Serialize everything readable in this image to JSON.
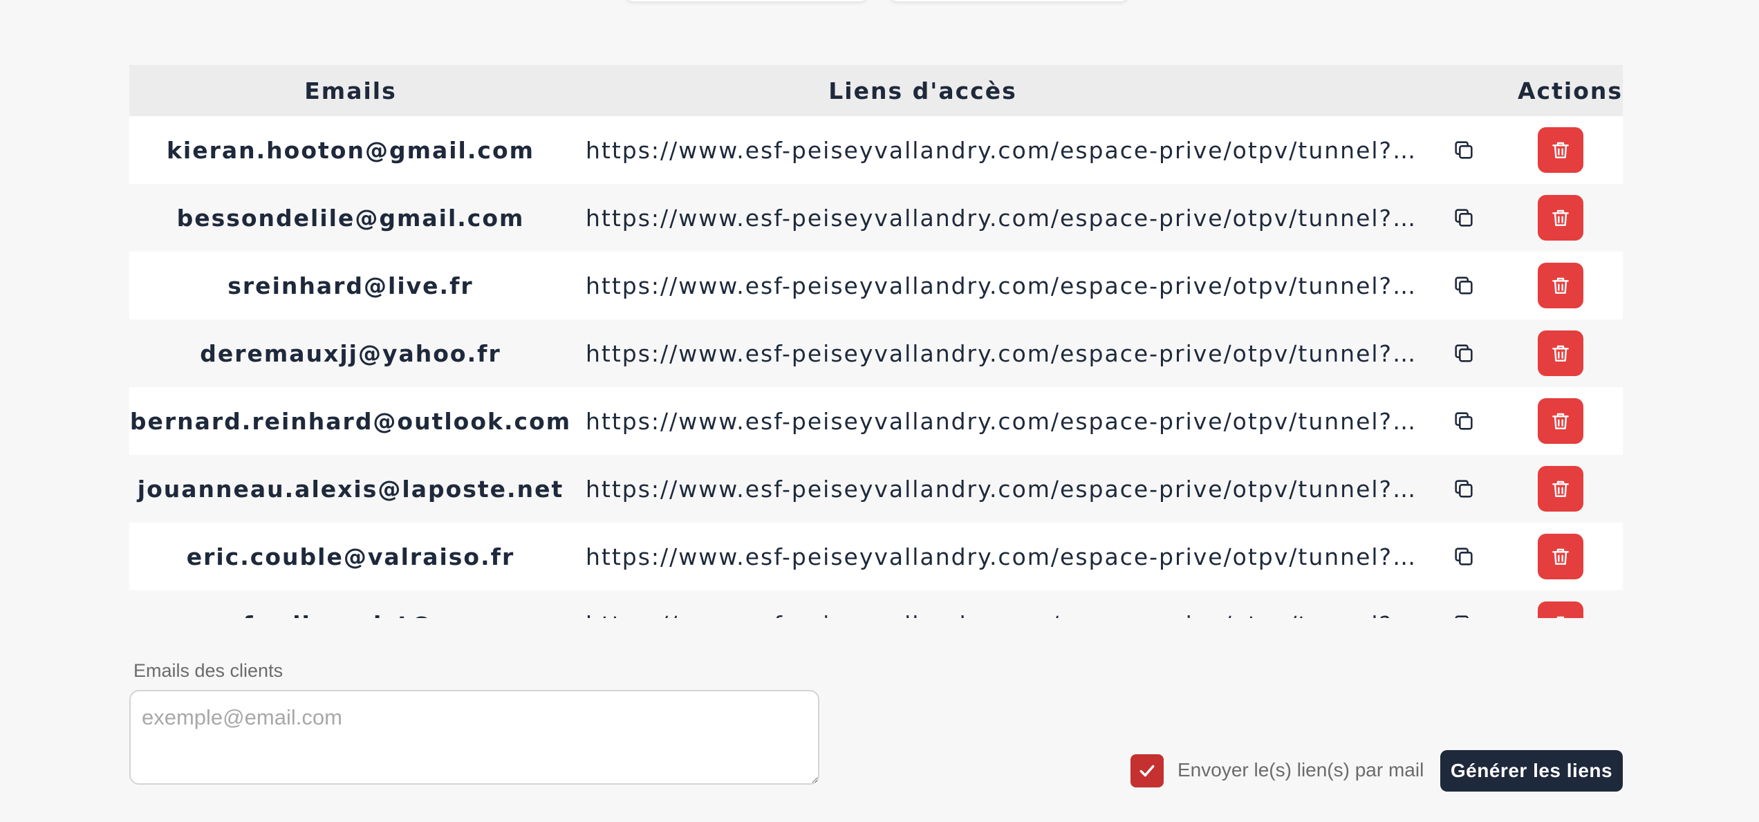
{
  "table": {
    "headers": {
      "emails": "Emails",
      "links": "Liens d'accès",
      "actions": "Actions"
    },
    "rows": [
      {
        "email": "kieran.hooton@gmail.com",
        "link": "https://www.esf-peiseyvallandry.com/espace-prive/otpv/tunnel?i…"
      },
      {
        "email": "bessondelile@gmail.com",
        "link": "https://www.esf-peiseyvallandry.com/espace-prive/otpv/tunnel?i…"
      },
      {
        "email": "sreinhard@live.fr",
        "link": "https://www.esf-peiseyvallandry.com/espace-prive/otpv/tunnel?i…"
      },
      {
        "email": "deremauxjj@yahoo.fr",
        "link": "https://www.esf-peiseyvallandry.com/espace-prive/otpv/tunnel?i…"
      },
      {
        "email": "bernard.reinhard@outlook.com",
        "link": "https://www.esf-peiseyvallandry.com/espace-prive/otpv/tunnel?i…"
      },
      {
        "email": "jouanneau.alexis@laposte.net",
        "link": "https://www.esf-peiseyvallandry.com/espace-prive/otpv/tunnel?i…"
      },
      {
        "email": "eric.couble@valraiso.fr",
        "link": "https://www.esf-peiseyvallandry.com/espace-prive/otpv/tunnel?i…"
      },
      {
        "email": "f.rolin.ouist@…",
        "link": "https://www.esf-peiseyvallandry.com/espace-prive/otpv/tunnel?i…"
      }
    ],
    "icons": {
      "copy": "copy-icon",
      "delete": "trash-icon"
    }
  },
  "form": {
    "emails_label": "Emails des clients",
    "emails_placeholder": "exemple@email.com",
    "emails_value": "",
    "send_by_mail_label": "Envoyer le(s) lien(s) par mail",
    "send_by_mail_checked": true,
    "generate_label": "Générer les liens"
  },
  "colors": {
    "primary_dark": "#1e293b",
    "danger": "#e53e3e",
    "checkbox": "#c53030"
  }
}
